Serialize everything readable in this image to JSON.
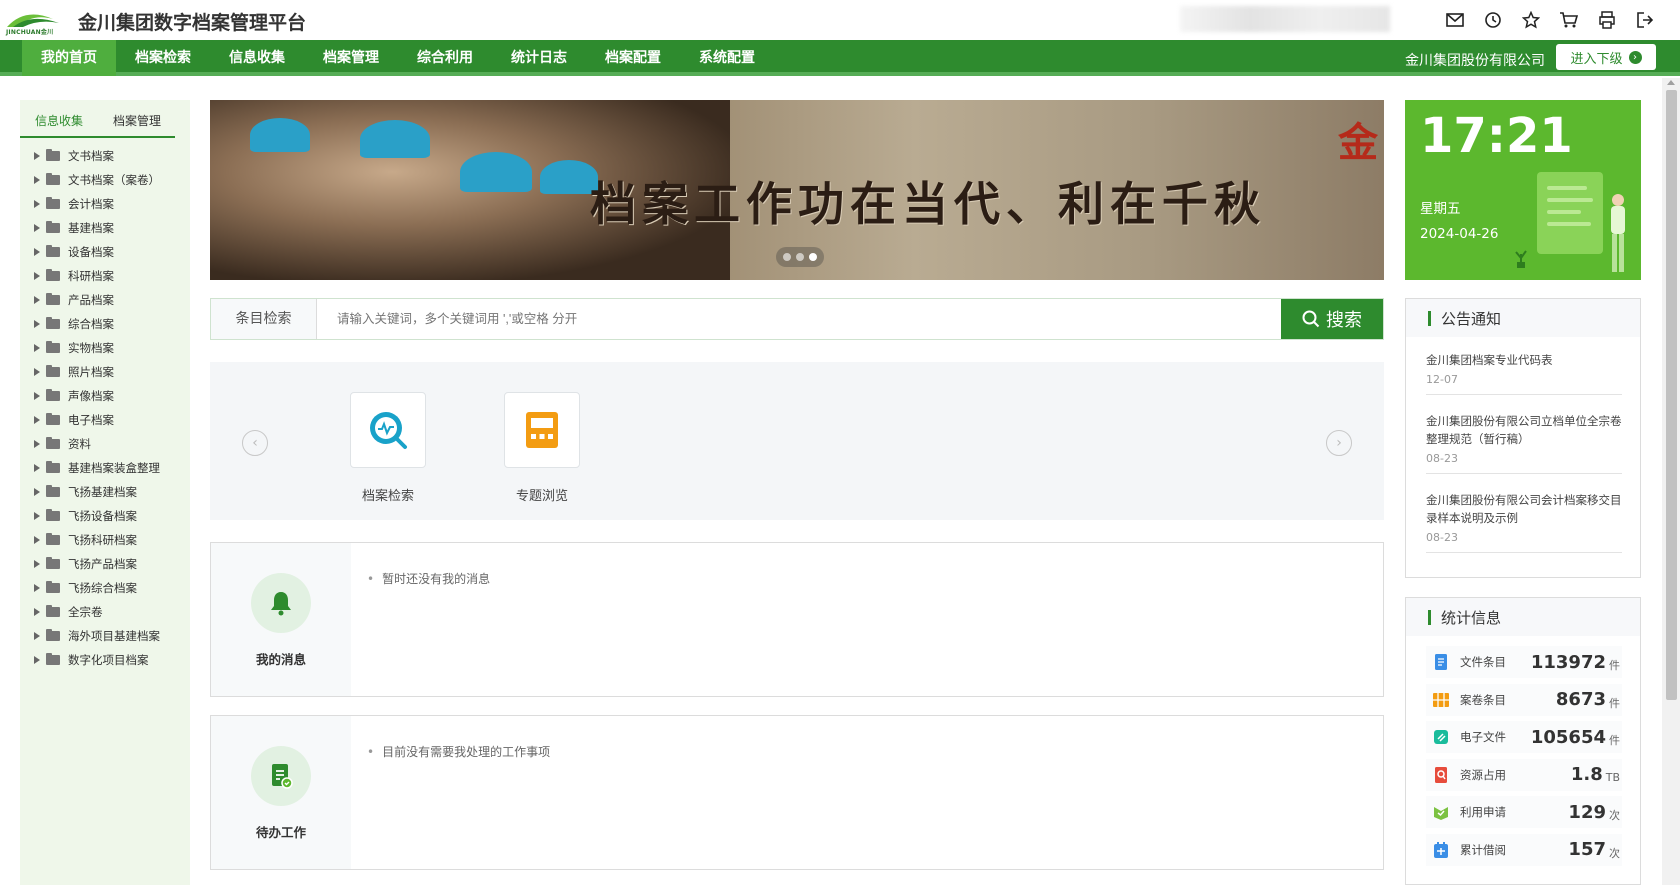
{
  "header": {
    "logo_text": "JINCHUAN金川",
    "title": "金川集团数字档案管理平台",
    "icons": [
      "mail-icon",
      "history-icon",
      "star-icon",
      "cart-icon",
      "print-icon",
      "logout-icon"
    ]
  },
  "nav": {
    "items": [
      "我的首页",
      "档案检索",
      "信息收集",
      "档案管理",
      "综合利用",
      "统计日志",
      "档案配置",
      "系统配置"
    ],
    "active_index": 0,
    "company": "金川集团股份有限公司",
    "enter_label": "进入下级"
  },
  "sidebar": {
    "tabs": [
      "信息收集",
      "档案管理"
    ],
    "active_tab": 0,
    "tree": [
      "文书档案",
      "文书档案（案卷）",
      "会计档案",
      "基建档案",
      "设备档案",
      "科研档案",
      "产品档案",
      "综合档案",
      "实物档案",
      "照片档案",
      "声像档案",
      "电子档案",
      "资料",
      "基建档案装盒整理",
      "飞扬基建档案",
      "飞扬设备档案",
      "飞扬科研档案",
      "飞扬产品档案",
      "飞扬综合档案",
      "全宗卷",
      "海外项目基建档案",
      "数字化项目档案"
    ]
  },
  "banner": {
    "slogan": "档案工作功在当代、利在千秋",
    "slide_count": 3,
    "active_slide": 2
  },
  "search": {
    "label": "条目检索",
    "placeholder": "请输入关键词，多个关键词用 ','或空格 分开",
    "button": "搜索"
  },
  "quick": {
    "items": [
      {
        "label": "档案检索",
        "icon": "archive-search-icon"
      },
      {
        "label": "专题浏览",
        "icon": "topic-browse-icon"
      }
    ]
  },
  "messages": {
    "title": "我的消息",
    "text": "暂时还没有我的消息"
  },
  "todo": {
    "title": "待办工作",
    "text": "目前没有需要我处理的工作事项"
  },
  "clock": {
    "time": "17:21",
    "weekday": "星期五",
    "date": "2024-04-26"
  },
  "notice": {
    "title": "公告通知",
    "items": [
      {
        "title": "金川集团档案专业代码表",
        "date": "12-07"
      },
      {
        "title": "金川集团股份有限公司立档单位全宗卷整理规范（暂行稿）",
        "date": "08-23"
      },
      {
        "title": "金川集团股份有限公司会计档案移交目录样本说明及示例",
        "date": "08-23"
      }
    ]
  },
  "stats": {
    "title": "统计信息",
    "items": [
      {
        "label": "文件条目",
        "value": "113972",
        "unit": "件",
        "color": "#3a8ee6"
      },
      {
        "label": "案卷条目",
        "value": "8673",
        "unit": "件",
        "color": "#f39c12"
      },
      {
        "label": "电子文件",
        "value": "105654",
        "unit": "件",
        "color": "#1abc9c"
      },
      {
        "label": "资源占用",
        "value": "1.8",
        "unit": "TB",
        "color": "#e74c3c"
      },
      {
        "label": "利用申请",
        "value": "129",
        "unit": "次",
        "color": "#7cc242"
      },
      {
        "label": "累计借阅",
        "value": "157",
        "unit": "次",
        "color": "#3a8ee6"
      }
    ]
  },
  "colors": {
    "primary": "#2e8b2e",
    "accent": "#5cb82e",
    "sidebar_bg": "#eff7ea"
  }
}
